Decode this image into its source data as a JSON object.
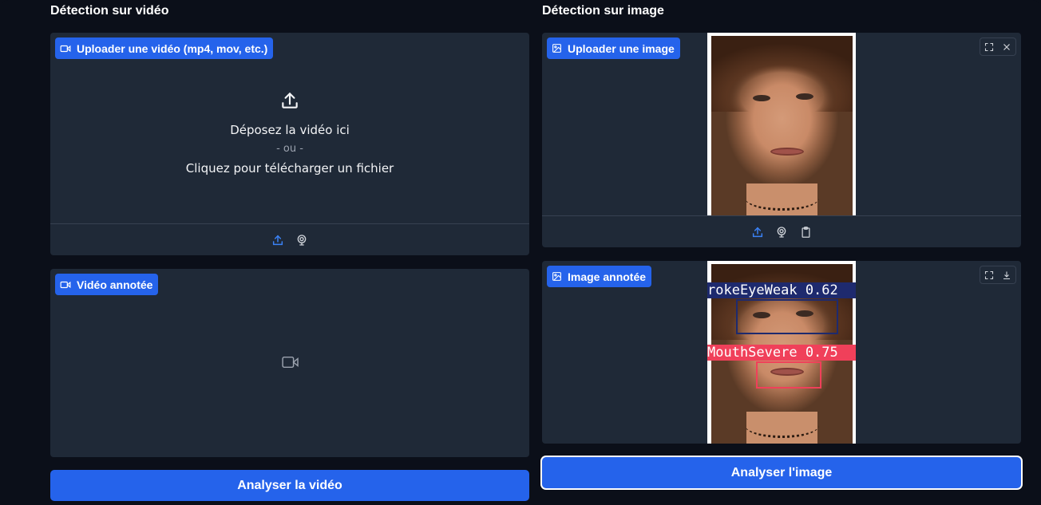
{
  "video_section": {
    "title": "Détection sur vidéo",
    "upload": {
      "label": "Uploader une vidéo (mp4, mov, etc.)",
      "drop_text": "Déposez la vidéo ici",
      "or_text": "- ou -",
      "click_text": "Cliquez pour télécharger un fichier",
      "sources": [
        "upload-icon",
        "webcam-icon"
      ]
    },
    "annotated": {
      "label": "Vidéo annotée",
      "placeholder_icon": "video-icon"
    },
    "analyze_label": "Analyser la vidéo"
  },
  "image_section": {
    "title": "Détection sur image",
    "upload": {
      "label": "Uploader une image",
      "sources": [
        "upload-icon",
        "webcam-icon",
        "clipboard-icon"
      ],
      "tools": [
        "fullscreen-icon",
        "close-icon"
      ]
    },
    "annotated": {
      "label": "Image annotée",
      "tools": [
        "fullscreen-icon",
        "download-icon"
      ],
      "detections": [
        {
          "label": "rokeEyeWeak 0.62",
          "color": "#1e2a6e"
        },
        {
          "label": "MouthSevere 0.75",
          "color": "#f0405a"
        }
      ]
    },
    "analyze_label": "Analyser l'image"
  },
  "colors": {
    "background": "#0b0f19",
    "panel": "#1f2937",
    "accent": "#2563eb"
  }
}
